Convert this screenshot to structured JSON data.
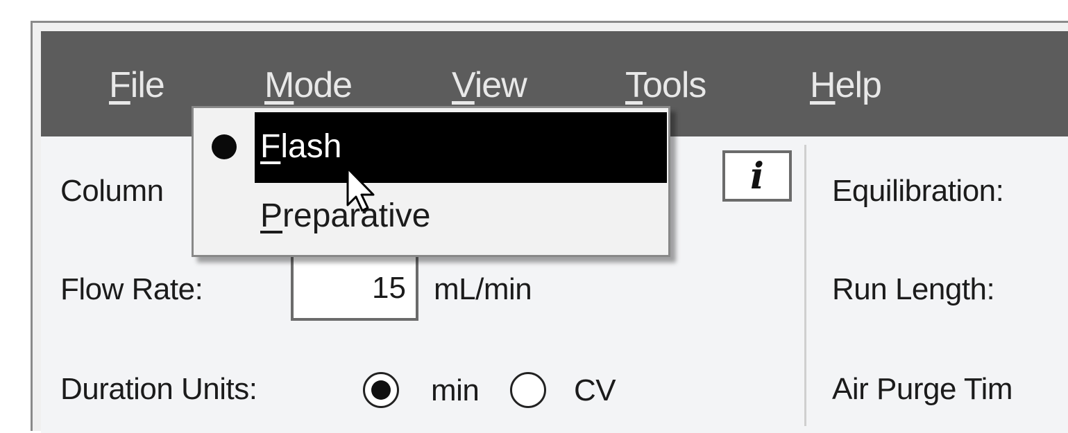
{
  "menubar": {
    "items": [
      {
        "key": "F",
        "rest": "ile"
      },
      {
        "key": "M",
        "rest": "ode"
      },
      {
        "key": "V",
        "rest": "iew"
      },
      {
        "key": "T",
        "rest": "ools"
      },
      {
        "key": "H",
        "rest": "elp"
      }
    ]
  },
  "dropdown": {
    "items": [
      {
        "key": "F",
        "rest": "lash",
        "checked": true
      },
      {
        "key": "P",
        "rest": "reparative",
        "checked": false
      }
    ]
  },
  "left_panel": {
    "column_label": "Column",
    "flow_rate_label": "Flow Rate:",
    "flow_rate_value": "15",
    "flow_rate_unit": "mL/min",
    "duration_units_label": "Duration Units:",
    "radio_min": "min",
    "radio_cv": "CV",
    "info_glyph": "i"
  },
  "right_panel": {
    "equilibration_label": "Equilibration:",
    "run_length_label": "Run Length:",
    "air_purge_label": "Air Purge Tim"
  },
  "colors": {
    "menubar_bg": "#5c5c5c",
    "selection_bg": "#000000",
    "panel_bg": "#f3f4f6"
  }
}
